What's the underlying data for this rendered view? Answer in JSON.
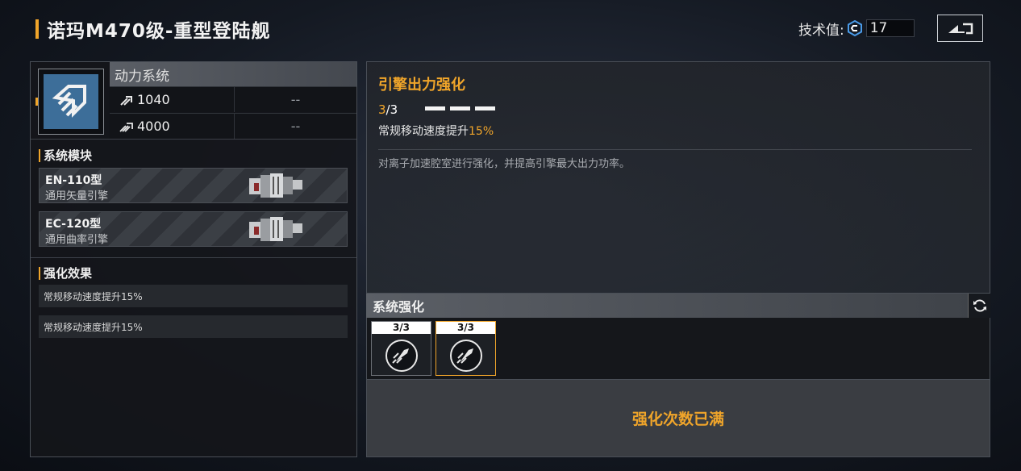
{
  "header": {
    "title": "诺玛M470级-重型登陆舰",
    "tech_label": "技术值:",
    "tech_value": "17",
    "back_icon": "return-icon"
  },
  "system": {
    "name": "动力系统",
    "icon": "power-system-icon",
    "stats": [
      {
        "icon": "speed-icon",
        "value": "1040",
        "alt": "--"
      },
      {
        "icon": "boost-speed-icon",
        "value": "4000",
        "alt": "--"
      }
    ]
  },
  "modules_section": {
    "title": "系统模块",
    "items": [
      {
        "name": "EN-110型",
        "sub": "通用矢量引擎"
      },
      {
        "name": "EC-120型",
        "sub": "通用曲率引擎"
      }
    ]
  },
  "effects_section": {
    "title": "强化效果",
    "items": [
      "常规移动速度提升15%",
      "常规移动速度提升15%"
    ]
  },
  "detail": {
    "title": "引擎出力强化",
    "level_current": "3",
    "level_rest": "/3",
    "pips": 3,
    "effect_prefix": "常规移动速度提升",
    "effect_value": "15%",
    "description": "对离子加速腔室进行强化，并提高引擎最大出力功率。"
  },
  "upgrade": {
    "title": "系统强化",
    "slots": [
      {
        "count": "3/3",
        "selected": false
      },
      {
        "count": "3/3",
        "selected": true
      }
    ],
    "status": "强化次数已满"
  },
  "colors": {
    "accent": "#f0a52a",
    "icon_blue": "#3d6e99"
  }
}
